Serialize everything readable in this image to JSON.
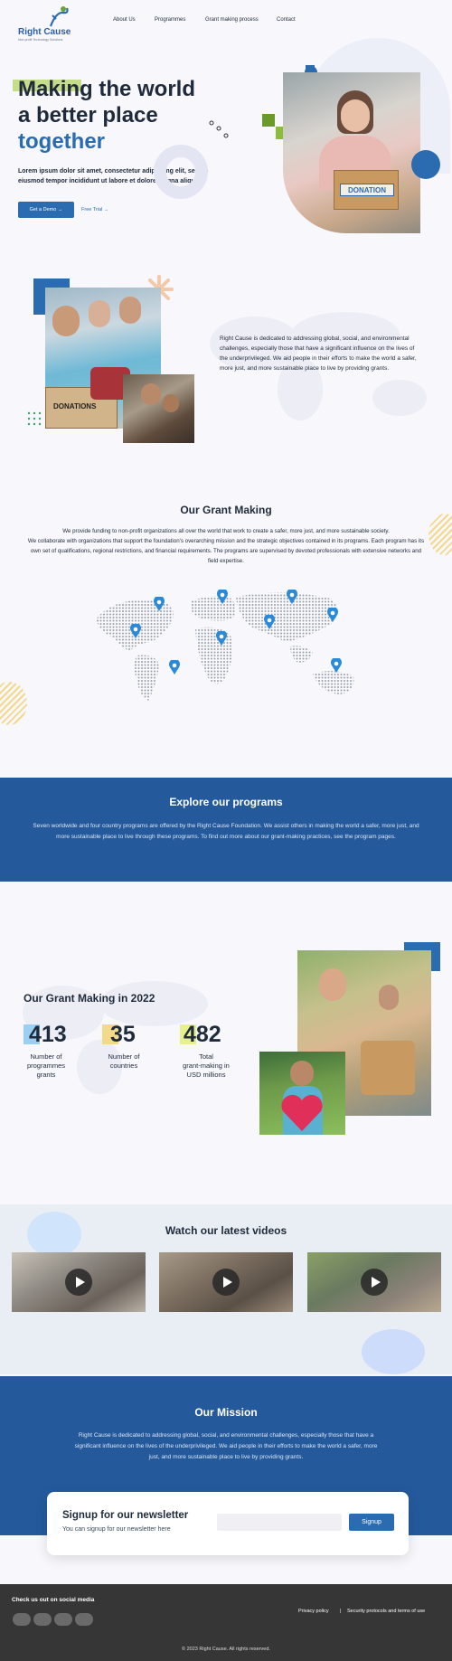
{
  "brand": {
    "name": "Right Cause",
    "tagline": "Non-profit Technology Solutions"
  },
  "nav": {
    "items": [
      "About Us",
      "Programmes",
      "Grant making process",
      "Contact"
    ]
  },
  "hero": {
    "title_line1": "Making the world",
    "title_line2": "a better place",
    "title_line3": "together",
    "description": "Lorem ipsum dolor sit amet, consectetur adipiscing elit, sed do eiusmod tempor incididunt ut labore et dolore magna aliqua.",
    "demo_label": "Get a Demo",
    "trial_label": "Free Trial",
    "box_label": "DONATION"
  },
  "about": {
    "text": "Right Cause is dedicated to addressing global, social, and environmental challenges, especially those that have a significant influence on the lives of the underprivileged. We aid people in their efforts to make the world a safer, more just, and more sustainable place to live by providing grants.",
    "box_label": "DONATIONS"
  },
  "grant_making": {
    "title": "Our Grant Making",
    "para1": "We provide funding to non-profit organizations all over the world that work to create a safer, more just, and more sustainable society.",
    "para2": "We collaborate with organizations that support the foundation's overarching mission and the strategic objectives contained in its programs. Each program has its own set of qualifications, regional restrictions, and financial requirements. The programs are supervised by devoted professionals with extensive networks and field expertise."
  },
  "explore": {
    "title": "Explore our programs",
    "text": "Seven worldwide and four country programs are offered by the Right Cause Foundation. We assist others in making the world a safer, more just, and more sustainable place to live through these programs. To find out more about our grant-making practices, see the program pages."
  },
  "stats": {
    "title": "Our Grant Making in 2022",
    "items": [
      {
        "value": "413",
        "label_line1": "Number of",
        "label_line2": "programmes",
        "label_line3": "grants",
        "color": "#9ccff2"
      },
      {
        "value": "35",
        "label_line1": "Number of",
        "label_line2": "countries",
        "label_line3": "",
        "color": "#f3d98a"
      },
      {
        "value": "482",
        "label_line1": "Total",
        "label_line2": "grant-making in",
        "label_line3": "USD millions",
        "color": "#e6f08c"
      }
    ]
  },
  "videos": {
    "title": "Watch our latest videos"
  },
  "mission": {
    "title": "Our Mission",
    "text": "Right Cause is dedicated to addressing global, social, and environmental challenges, especially those that have a significant influence on the lives of the underprivileged. We aid people in their efforts to make the world a safer, more just, and more sustainable place to live by providing grants."
  },
  "newsletter": {
    "title": "Signup for our newsletter",
    "subtitle": "You can signup for our newsletter here",
    "placeholder": "",
    "button_label": "Signup"
  },
  "footer": {
    "social_heading": "Check us out on social media",
    "privacy": "Privacy policy",
    "separator": "|",
    "security": "Security protocols and terms of use",
    "copyright": "© 2023 Right Cause. All rights reserved."
  },
  "colors": {
    "primary": "#2b6cb0",
    "band": "#245a9c",
    "accent_green": "#c5dc8a",
    "footer": "#363636"
  }
}
